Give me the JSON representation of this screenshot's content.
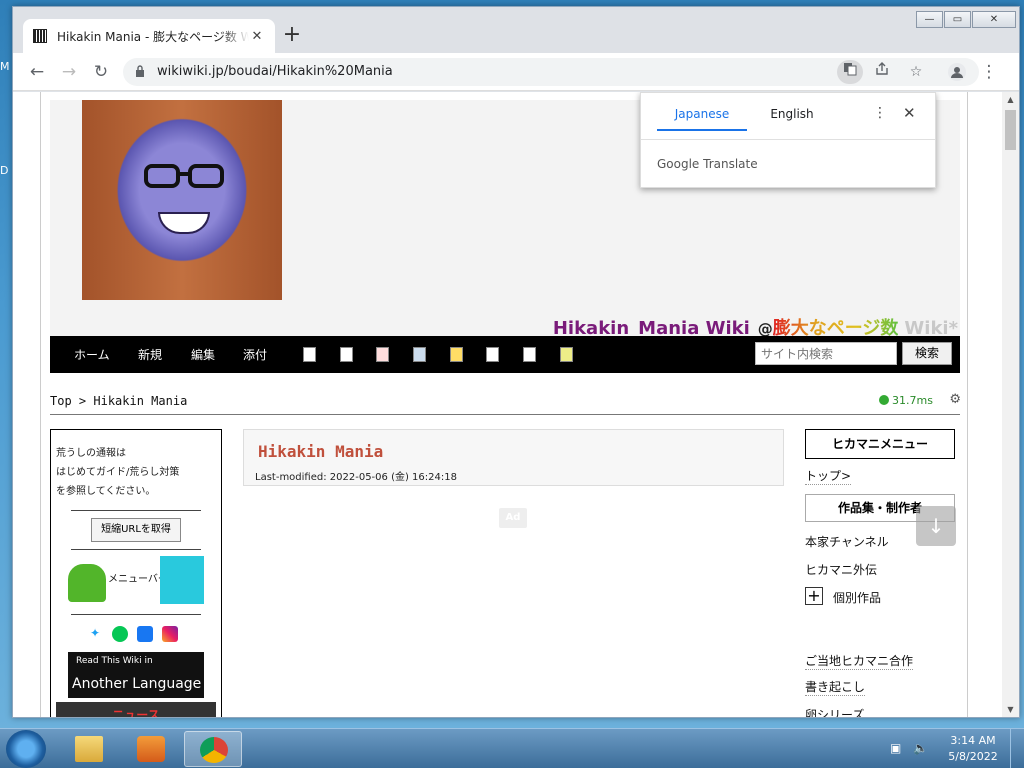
{
  "desktop": {
    "frag1": "M",
    "frag2": "D"
  },
  "window": {
    "min": "—",
    "max": "▭",
    "close": "✕"
  },
  "tab": {
    "title": "Hikakin Mania - 膨大なページ数 Wiki*",
    "close": "✕"
  },
  "toolbar": {
    "url": "wikiwiki.jp/boudai/Hikakin%20Mania",
    "back": "←",
    "forward": "→",
    "reload": "↻",
    "menu": "⋮",
    "newtab": "+"
  },
  "translate": {
    "tab1": "Japanese",
    "tab2": "English",
    "brand": "Google Translate",
    "more": "⋮",
    "close": "✕"
  },
  "site": {
    "title_part1": "Hikakin_Mania Wiki",
    "title_at": "@",
    "title_part2": "膨大なページ数",
    "title_part3": "Wiki*",
    "nav": [
      "ホーム",
      "新規",
      "編集",
      "添付"
    ],
    "search_placeholder": "サイト内検索",
    "search_button": "検索",
    "breadcrumb_top": "Top",
    "breadcrumb_sep": " > ",
    "breadcrumb_page": "Hikakin Mania",
    "timing": "31.7ms"
  },
  "lside": {
    "notice_1": "荒うしの通報は",
    "notice_2": "はじめてガイド/荒らし対策",
    "notice_3": "を参照してください。",
    "shorturl": "短縮URLを取得",
    "menubar": "メニューバー",
    "another_1": "Read This Wiki in",
    "another_2": "Another Language",
    "news": "ニュース"
  },
  "main": {
    "title": "Hikakin Mania",
    "last_modified": "Last-modified: 2022-05-06 (金) 16:24:18",
    "ad": "Ad"
  },
  "rside": {
    "menu_head": "ヒカマニメニュー",
    "top_link": "トップ>",
    "works_head": "作品集・制作者",
    "link_honke": "本家チャンネル",
    "link_gaiden": "ヒカマニ外伝",
    "plus": "+",
    "link_kobetsu": "個別作品",
    "link_gotochi": "ご当地ヒカマニ合作",
    "link_kakiokoshi": "書き起こし",
    "link_tamago": "卵シリーズ"
  },
  "taskbar": {
    "time": "3:14 AM",
    "date": "5/8/2022"
  },
  "colors": {
    "accent": "#1a73e8",
    "title_purple": "#7a1b7a",
    "page_title": "#c0503c"
  }
}
